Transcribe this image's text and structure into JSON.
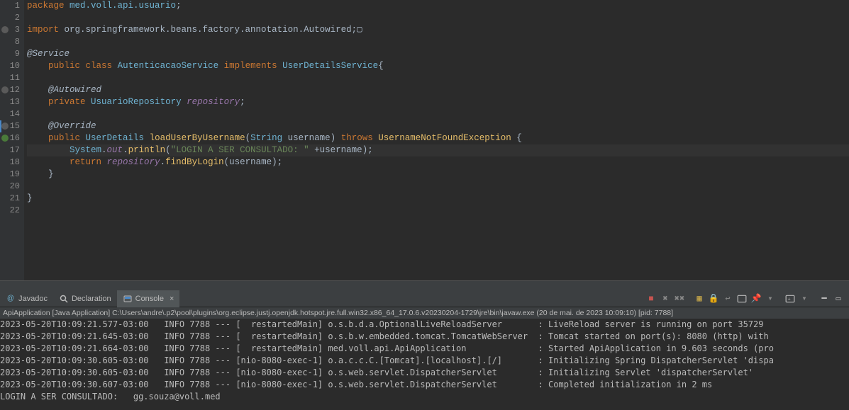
{
  "code": {
    "lines": [
      {
        "n": "1",
        "html": "<span class='kw'>package</span> <span class='id'>med.voll.api.usuario</span>;"
      },
      {
        "n": "2",
        "html": ""
      },
      {
        "n": "3",
        "marker": "plus",
        "html": "<span class='kw'>import</span> org.springframework.beans.factory.annotation.Autowired;▢"
      },
      {
        "n": "8",
        "html": ""
      },
      {
        "n": "9",
        "html": "<span class='ann'>@Service</span>"
      },
      {
        "n": "10",
        "html": "    <span class='kw'>public</span> <span class='kw'>class</span> <span class='cls'>AutenticacaoService</span> <span class='kw'>implements</span> <span class='cls'>UserDetailsService</span>{"
      },
      {
        "n": "11",
        "html": ""
      },
      {
        "n": "12",
        "marker": "dot",
        "html": "    <span class='ann'>@Autowired</span>"
      },
      {
        "n": "13",
        "html": "    <span class='kw'>private</span> <span class='cls'>UsuarioRepository</span> <span class='fld'>repository</span>;"
      },
      {
        "n": "14",
        "html": ""
      },
      {
        "n": "15",
        "marker": "dot",
        "blue": true,
        "html": "    <span class='ann'>@Override</span>"
      },
      {
        "n": "16",
        "marker": "green",
        "html": "    <span class='kw'>public</span> <span class='cls'>UserDetails</span> <span class='mtd'>loadUserByUsername</span>(<span class='cls'>String</span> <span class='param'>username</span>) <span class='kw'>throws</span> <span class='ex'>UsernameNotFoundException</span> {"
      },
      {
        "n": "17",
        "current": true,
        "html": "        <span class='cls'>System</span>.<span class='fld'>out</span>.<span class='mtd'>println</span>(<span class='str'>\"LOGIN A SER CONSULTADO: \"</span> +<span class='param'>username</span>);"
      },
      {
        "n": "18",
        "html": "        <span class='kw'>return</span> <span class='fld'>repository</span>.<span class='mtd'>findByLogin</span>(<span class='param'>username</span>);"
      },
      {
        "n": "19",
        "html": "    }"
      },
      {
        "n": "20",
        "html": ""
      },
      {
        "n": "21",
        "html": "}"
      },
      {
        "n": "22",
        "html": ""
      }
    ]
  },
  "tabs": {
    "javadoc": "Javadoc",
    "declaration": "Declaration",
    "console": "Console"
  },
  "consoleMeta": "ApiApplication [Java Application] C:\\Users\\andre\\.p2\\pool\\plugins\\org.eclipse.justj.openjdk.hotspot.jre.full.win32.x86_64_17.0.6.v20230204-1729\\jre\\bin\\javaw.exe  (20 de mai. de 2023 10:09:10) [pid: 7788]",
  "consoleLines": [
    "2023-05-20T10:09:21.577-03:00   INFO 7788 --- [  restartedMain] o.s.b.d.a.OptionalLiveReloadServer       : LiveReload server is running on port 35729",
    "2023-05-20T10:09:21.645-03:00   INFO 7788 --- [  restartedMain] o.s.b.w.embedded.tomcat.TomcatWebServer  : Tomcat started on port(s): 8080 (http) with ",
    "2023-05-20T10:09:21.664-03:00   INFO 7788 --- [  restartedMain] med.voll.api.ApiApplication              : Started ApiApplication in 9.603 seconds (pro",
    "2023-05-20T10:09:30.605-03:00   INFO 7788 --- [nio-8080-exec-1] o.a.c.c.C.[Tomcat].[localhost].[/]       : Initializing Spring DispatcherServlet 'dispa",
    "2023-05-20T10:09:30.605-03:00   INFO 7788 --- [nio-8080-exec-1] o.s.web.servlet.DispatcherServlet        : Initializing Servlet 'dispatcherServlet'",
    "2023-05-20T10:09:30.607-03:00   INFO 7788 --- [nio-8080-exec-1] o.s.web.servlet.DispatcherServlet        : Completed initialization in 2 ms",
    "LOGIN A SER CONSULTADO:   gg.souza@voll.med"
  ],
  "icons": {
    "at": "@",
    "decl": "🔍",
    "console": "📟"
  }
}
